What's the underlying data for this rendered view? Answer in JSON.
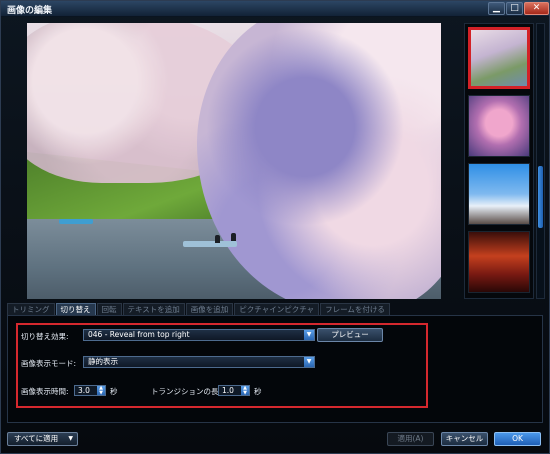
{
  "window": {
    "title": "画像の編集",
    "min_glyph": "▁",
    "max_glyph": "□",
    "close_glyph": "✕"
  },
  "thumbnails": [
    {
      "selected": true
    },
    {
      "selected": false
    },
    {
      "selected": false
    },
    {
      "selected": false
    }
  ],
  "tabs": [
    "トリミング",
    "切り替え",
    "回転",
    "テキストを追加",
    "画像を追加",
    "ピクチャインピクチャ",
    "フレームを付ける"
  ],
  "active_tab": "切り替え",
  "transition": {
    "effect_label": "切り替え効果:",
    "effect_value": "046 - Reveal from top right",
    "preview_button": "プレビュー",
    "display_mode_label": "画像表示モード:",
    "display_mode_value": "静的表示",
    "display_time_label": "画像表示時間:",
    "display_time_value": "3.0",
    "display_time_unit": "秒",
    "transition_length_label": "トランジションの長さ:",
    "transition_length_value": "1.0",
    "transition_length_unit": "秒"
  },
  "footer": {
    "apply_all": "すべてに適用",
    "apply": "適用(A)",
    "cancel": "キャンセル",
    "ok": "OK"
  },
  "colors": {
    "highlight": "#d5282e",
    "accent": "#3f8fe0"
  }
}
